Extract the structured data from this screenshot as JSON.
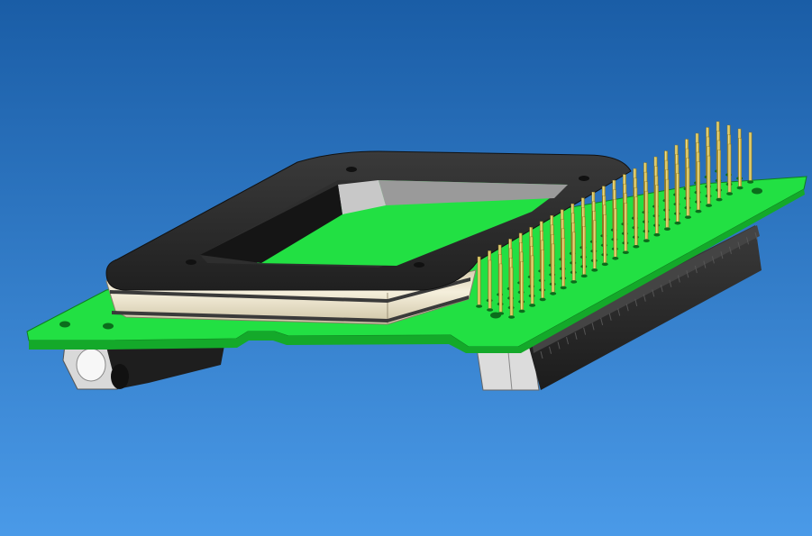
{
  "scene": {
    "kind": "cad-3d-render",
    "background_top": "#1a5da6",
    "background_bottom": "#4a9ae8",
    "pcb_color": "#22e043",
    "pcb_edge_color": "#14a92a",
    "frame_color": "#2b2b2b",
    "gasket_color": "#efe6cc",
    "pin_color": "#d4bd52",
    "connector_color": "#2a2a2a",
    "parts": [
      "pcb-board",
      "socket-frame",
      "socket-gasket",
      "pin-header",
      "edge-connector",
      "side-latch",
      "mounting-hole"
    ]
  }
}
